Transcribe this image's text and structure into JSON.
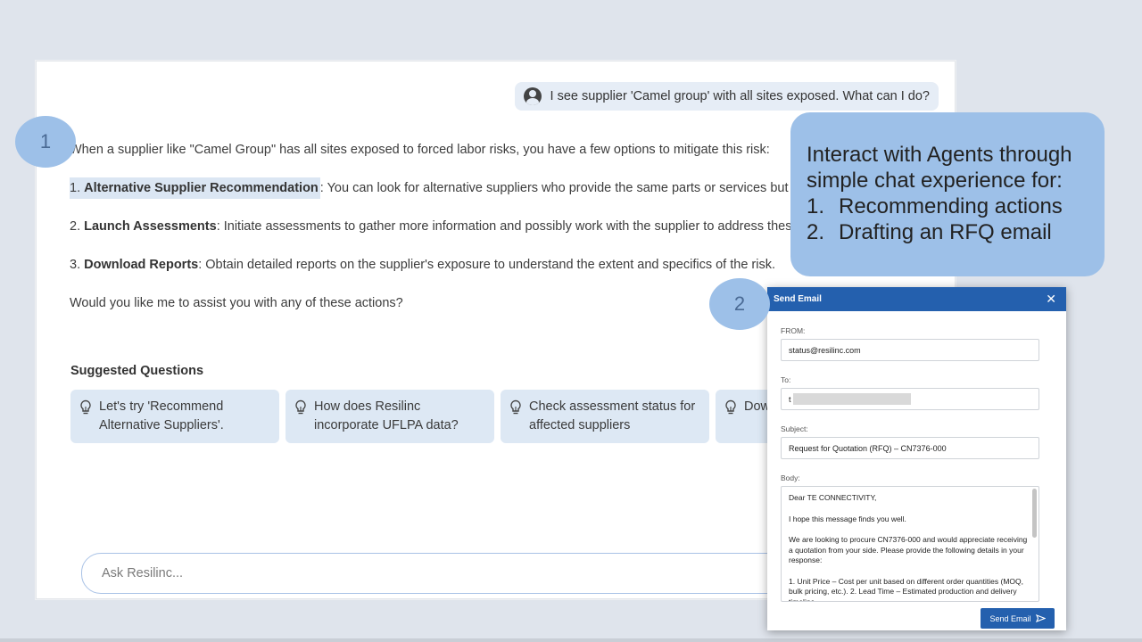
{
  "chat": {
    "user_message": "I see supplier 'Camel group' with all sites exposed. What can I do?",
    "intro": "When a supplier like \"Camel Group\" has all sites exposed to forced labor risks, you have a few options to mitigate this risk:",
    "options": [
      {
        "number": "1.",
        "title": "Alternative Supplier Recommendation",
        "text": ": You can look for alternative suppliers who provide the same parts or services but with lower forced labor risks."
      },
      {
        "number": "2.",
        "title": "Launch Assessments",
        "text": ": Initiate assessments to gather more information and possibly work with the supplier to address these risks."
      },
      {
        "number": "3.",
        "title": "Download Reports",
        "text": ": Obtain detailed reports on the supplier's exposure to understand the extent and specifics of the risk."
      }
    ],
    "closing": "Would you like me to assist you with any of these actions?",
    "suggested_title": "Suggested Questions",
    "suggestions": [
      {
        "text": "Let's try 'Recommend Alternative Suppliers'.",
        "icon": "lightbulb-icon"
      },
      {
        "text": "How does Resilinc incorporate UFLPA data?",
        "icon": "lightbulb-icon"
      },
      {
        "text": "Check assessment status for affected suppliers",
        "icon": "lightbulb-icon"
      },
      {
        "text": "Download reports",
        "icon": "lightbulb-icon"
      }
    ],
    "input_placeholder": "Ask Resilinc..."
  },
  "steps": {
    "one": "1",
    "two": "2"
  },
  "callout": {
    "line1": "Interact with Agents through simple chat experience for:",
    "items": [
      {
        "num": "1.",
        "text": "Recommending actions"
      },
      {
        "num": "2.",
        "text": "Drafting an RFQ email"
      }
    ]
  },
  "email": {
    "title": "Send Email",
    "from_label": "FROM:",
    "from_value": "status@resilinc.com",
    "to_label": "To:",
    "to_value": "t",
    "subject_label": "Subject:",
    "subject_value": "Request for Quotation (RFQ) – CN7376-000",
    "body_label": "Body:",
    "body_paragraphs": [
      "Dear TE CONNECTIVITY,",
      "I hope this message finds you well.",
      "We are looking to procure CN7376-000 and would appreciate receiving a quotation from your side. Please provide the following details in your response:",
      "1. Unit Price – Cost per unit based on different order quantities (MOQ, bulk pricing, etc.). 2. Lead Time – Estimated production and delivery timeline."
    ],
    "send_label": "Send Email"
  },
  "colors": {
    "accent": "#2460ae",
    "callout": "#9dc0e8",
    "chip": "#dde8f4",
    "background": "#dfe4ec"
  }
}
